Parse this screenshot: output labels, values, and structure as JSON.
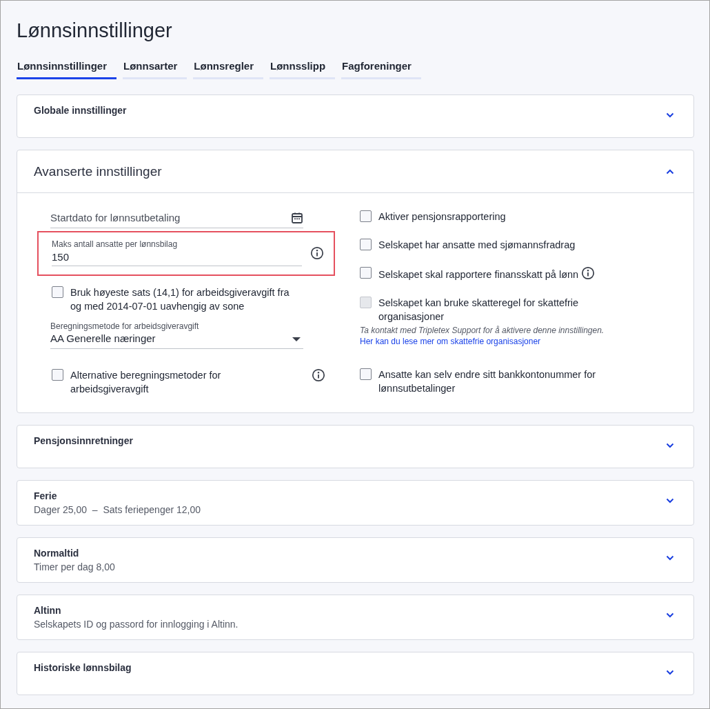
{
  "page_title": "Lønnsinnstillinger",
  "tabs": [
    {
      "label": "Lønnsinnstillinger",
      "selected": true
    },
    {
      "label": "Lønnsarter",
      "selected": false
    },
    {
      "label": "Lønnsregler",
      "selected": false
    },
    {
      "label": "Lønnsslipp",
      "selected": false
    },
    {
      "label": "Fagforeninger",
      "selected": false
    }
  ],
  "sections": [
    {
      "title": "Globale innstillinger",
      "expanded": false
    },
    {
      "title": "Avanserte innstillinger",
      "expanded": true,
      "left": [
        {
          "kind": "date",
          "placeholder": "Startdato for lønnsutbetaling"
        },
        {
          "kind": "number",
          "label": "Maks antall ansatte per lønnsbilag",
          "value": "150",
          "info": true,
          "highlighted": true
        },
        {
          "kind": "checkbox",
          "label": "Bruk høyeste sats (14,1) for arbeidsgiveravgift fra og med 2014-07-01 uavhengig av sone",
          "checked": false
        },
        {
          "kind": "select",
          "label": "Beregningsmetode for arbeidsgiveravgift",
          "value": "AA Generelle næringer"
        },
        {
          "kind": "checkbox",
          "label": "Alternative beregningsmetoder for arbeidsgiveravgift",
          "checked": false,
          "info": true
        }
      ],
      "right": [
        {
          "label": "Aktiver pensjonsrapportering",
          "checked": false,
          "disabled": false
        },
        {
          "label": "Selskapet har ansatte med sjømannsfradrag",
          "checked": false,
          "disabled": false
        },
        {
          "label": "Selskapet skal rapportere finansskatt på lønn",
          "checked": false,
          "disabled": false,
          "info": true
        },
        {
          "label": "Selskapet kan bruke skatteregel for skattefrie organisasjoner",
          "checked": false,
          "disabled": true,
          "note": "Ta kontakt med Tripletex Support for å aktivere denne innstillingen.",
          "link": "Her kan du lese mer om skattefrie organisasjoner"
        },
        {
          "label": "Ansatte kan selv endre sitt bankkontonummer for lønnsutbetalinger",
          "checked": false,
          "disabled": false
        }
      ]
    },
    {
      "title": "Pensjonsinnretninger",
      "expanded": false
    },
    {
      "title": "Ferie",
      "subtitle": "Dager 25,00  –  Sats feriepenger 12,00",
      "expanded": false
    },
    {
      "title": "Normaltid",
      "subtitle": "Timer per dag 8,00",
      "expanded": false
    },
    {
      "title": "Altinn",
      "subtitle": "Selskapets ID og passord for innlogging i Altinn.",
      "expanded": false
    },
    {
      "title": "Historiske lønnsbilag",
      "expanded": false
    }
  ]
}
